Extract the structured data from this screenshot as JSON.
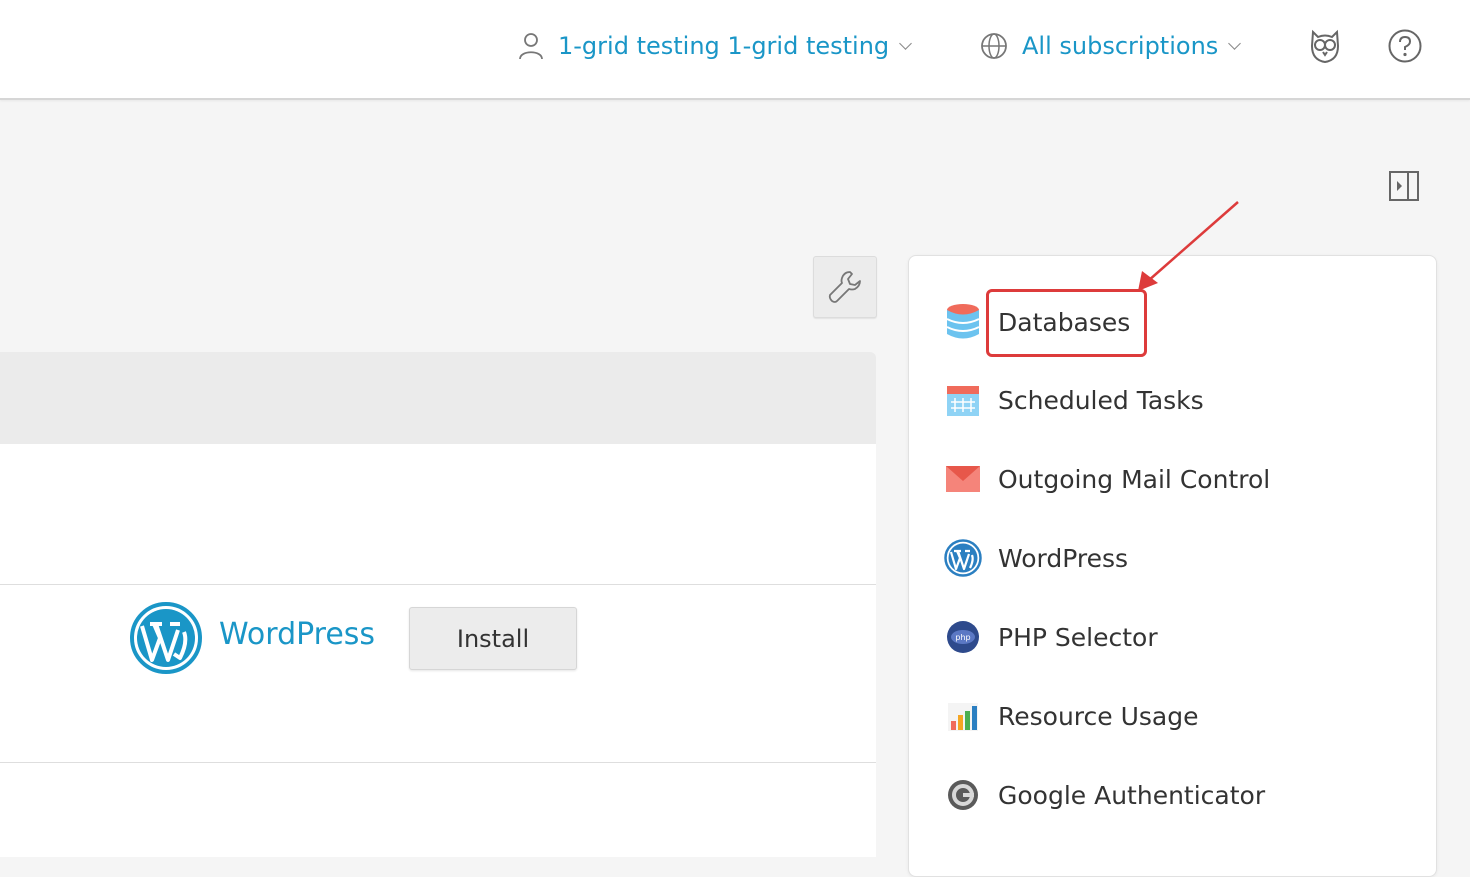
{
  "header": {
    "user_label": "1-grid testing 1-grid testing",
    "subscriptions_label": "All subscriptions"
  },
  "main": {
    "app_name": "WordPress",
    "install_label": "Install"
  },
  "tools": {
    "items": [
      {
        "label": "Databases",
        "icon": "database-icon"
      },
      {
        "label": "Scheduled Tasks",
        "icon": "calendar-icon"
      },
      {
        "label": "Outgoing Mail Control",
        "icon": "mail-icon"
      },
      {
        "label": "WordPress",
        "icon": "wordpress-icon"
      },
      {
        "label": "PHP Selector",
        "icon": "php-icon"
      },
      {
        "label": "Resource Usage",
        "icon": "bar-chart-icon"
      },
      {
        "label": "Google Authenticator",
        "icon": "google-authenticator-icon"
      }
    ]
  },
  "colors": {
    "link": "#1a96c7",
    "annotation": "#dd3b3b"
  }
}
